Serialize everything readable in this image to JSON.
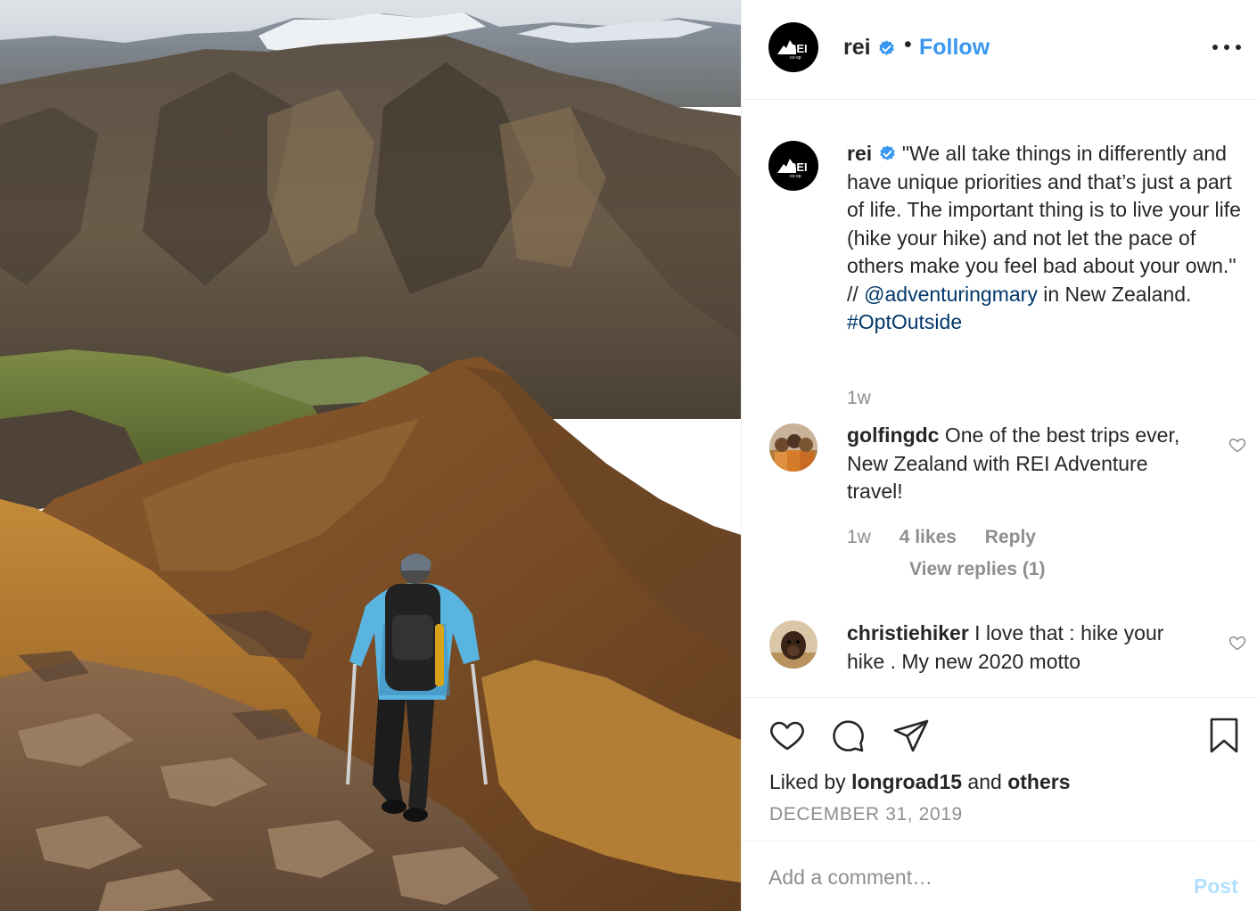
{
  "post": {
    "photo_icon": "mountain-hiker-photo",
    "author": {
      "username": "rei",
      "verified": true,
      "logo_text": "REI",
      "logo_sub": "co-op"
    },
    "header": {
      "separator": "•",
      "follow_label": "Follow",
      "more_icon": "more-horizontal-icon"
    },
    "caption": {
      "username": "rei",
      "text": "\"We all take things in differently and have unique priorities and that’s just a part of life. The important thing is to live your life (hike your hike) and not let the pace of others make you feel bad about your own.\" //",
      "mention": "@adventuringmary",
      "after_mention": " in New Zealand.",
      "hashtag": "#OptOutside",
      "time": "1w"
    },
    "comments": [
      {
        "username": "golfingdc",
        "text": " One of the best trips ever, New Zealand with REI Adventure travel!",
        "time": "1w",
        "likes": "4 likes",
        "reply_label": "Reply",
        "view_replies": "View replies (1)"
      },
      {
        "username": "christiehiker",
        "text": " I love that : hike your hike . My new 2020 motto"
      }
    ],
    "actions": {
      "like_icon": "heart-icon",
      "comment_icon": "comment-icon",
      "share_icon": "share-icon",
      "save_icon": "bookmark-icon"
    },
    "likes": {
      "prefix": "Liked by ",
      "user": "longroad15",
      "middle": " and ",
      "others": "others"
    },
    "date": "DECEMBER 31, 2019",
    "add_comment": {
      "placeholder": "Add a comment…",
      "post_label": "Post"
    },
    "colors": {
      "link_blue": "#3897f0",
      "post_disabled": "#b2dffc",
      "mention": "#00376b",
      "muted": "#8e8e8e",
      "verified_badge": "#3897f0"
    }
  }
}
